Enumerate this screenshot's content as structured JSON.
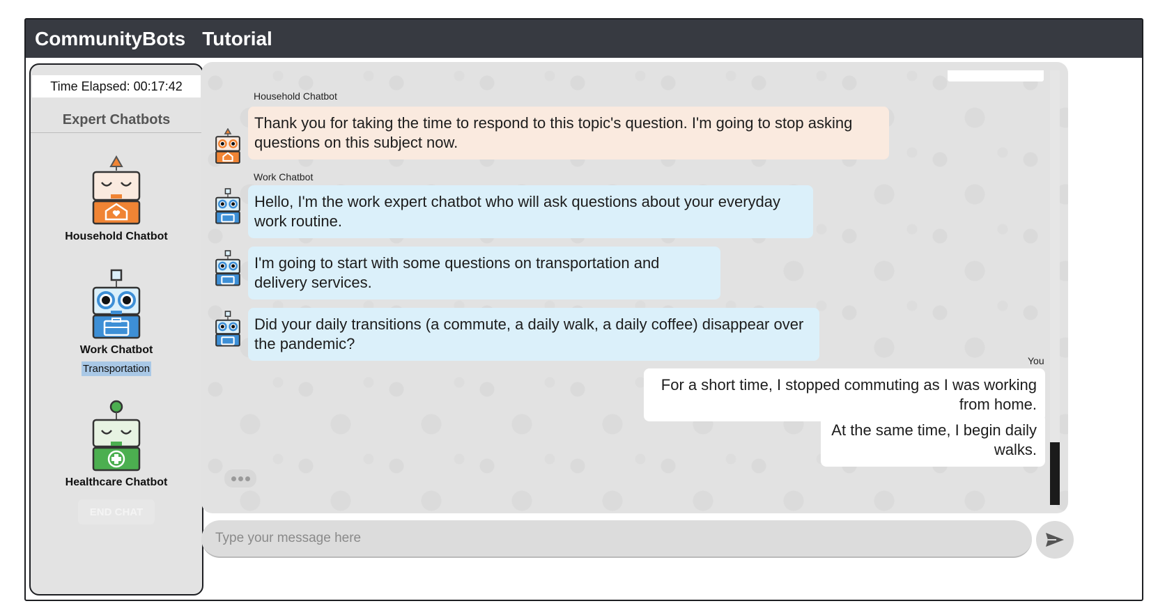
{
  "header": {
    "brand": "CommunityBots",
    "tutorial_link": "Tutorial"
  },
  "sidebar": {
    "timer": "Time Elapsed: 00:17:42",
    "section_title": "Expert Chatbots",
    "bots": [
      {
        "name": "Household Chatbot",
        "icon": "household-robot-icon",
        "color": "#f08434"
      },
      {
        "name": "Work Chatbot",
        "topic": "Transportation",
        "icon": "work-robot-icon",
        "color": "#3d8fd6"
      },
      {
        "name": "Healthcare Chatbot",
        "icon": "healthcare-robot-icon",
        "color": "#4caf50"
      }
    ],
    "end_chat_label": "END CHAT"
  },
  "chat": {
    "messages": [
      {
        "sender": "Household Chatbot",
        "text": "Thank you for taking the time to respond to this topic's question. I'm going to stop asking questions on this subject now."
      },
      {
        "sender": "Work Chatbot",
        "text": "Hello, I'm the work expert chatbot who will ask questions about your everyday work routine."
      },
      {
        "sender": "Work Chatbot",
        "text": "I'm going to start with some questions on transportation and delivery services."
      },
      {
        "sender": "Work Chatbot",
        "text": "Did your daily transitions (a commute, a daily walk, a daily coffee) disappear over the pandemic?"
      },
      {
        "sender": "You",
        "text": "For a short time, I stopped commuting as I was working from home."
      },
      {
        "sender": "You",
        "text": "At the same time, I begin daily walks."
      }
    ],
    "typing_indicator": "typing-dots-icon"
  },
  "composer": {
    "placeholder": "Type your message here",
    "value": "",
    "send_icon": "send-arrow-icon"
  },
  "colors": {
    "header_bg": "#373a41",
    "household_bubble": "#faeadf",
    "work_bubble": "#dbf0fa",
    "user_bubble": "#ffffff",
    "topic_highlight": "#a9c8e6"
  }
}
